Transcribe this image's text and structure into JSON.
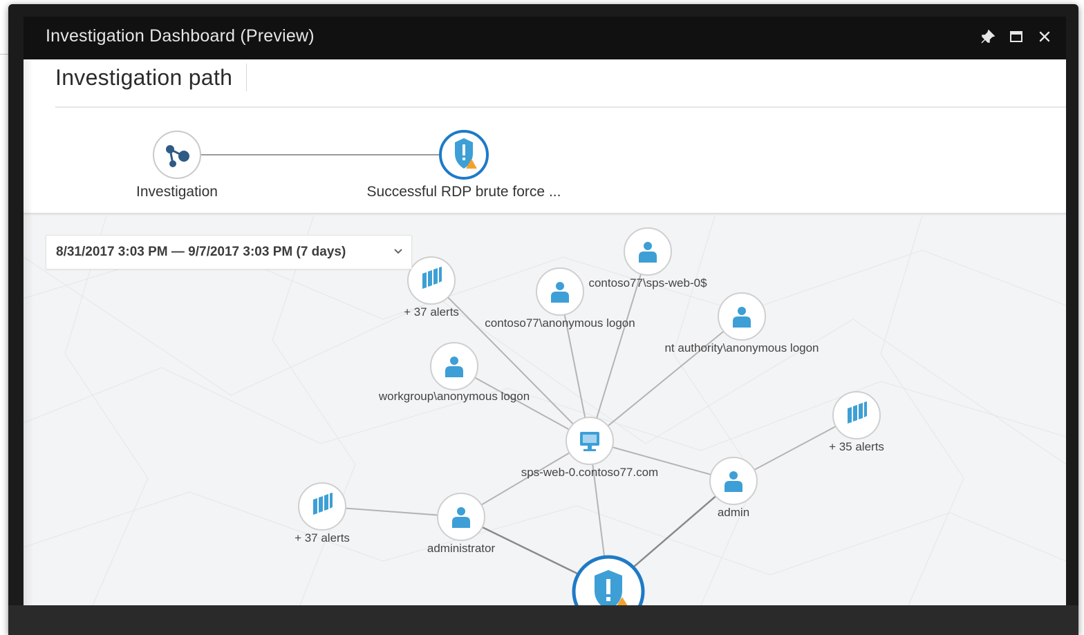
{
  "window": {
    "title": "Investigation Dashboard (Preview)",
    "controls": [
      {
        "name": "pin-icon",
        "label": "Pin"
      },
      {
        "name": "maximize-icon",
        "label": "Maximize"
      },
      {
        "name": "close-icon",
        "label": "Close"
      }
    ]
  },
  "header": {
    "title": "Investigation path",
    "breadcrumb": [
      {
        "label": "Investigation",
        "icon": "graph-icon"
      },
      {
        "label": "Successful RDP brute force ...",
        "icon": "shield-alert-icon"
      }
    ]
  },
  "date_range": {
    "value": "8/31/2017 3:03 PM — 9/7/2017 3:03 PM (7 days)"
  },
  "graph": {
    "center": {
      "label": "sps-web-0.contoso77.com",
      "icon": "computer-icon"
    },
    "nodes": [
      {
        "label": "contoso77\\sps-web-0$",
        "icon": "user-icon"
      },
      {
        "label": "contoso77\\anonymous logon",
        "icon": "user-icon"
      },
      {
        "label": "+ 37 alerts",
        "icon": "alerts-icon"
      },
      {
        "label": "nt authority\\anonymous logon",
        "icon": "user-icon"
      },
      {
        "label": "workgroup\\anonymous logon",
        "icon": "user-icon"
      },
      {
        "label": "+ 35 alerts",
        "icon": "alerts-icon"
      },
      {
        "label": "admin",
        "icon": "user-icon"
      },
      {
        "label": "+ 37 alerts",
        "icon": "alerts-icon"
      },
      {
        "label": "administrator",
        "icon": "user-icon"
      }
    ],
    "alert_node": {
      "icon": "shield-alert-icon"
    }
  },
  "colors": {
    "accent": "#1e7ac7",
    "icon_blue": "#3d9fd6",
    "warning": "#f2a22c",
    "titlebar": "#111111"
  }
}
